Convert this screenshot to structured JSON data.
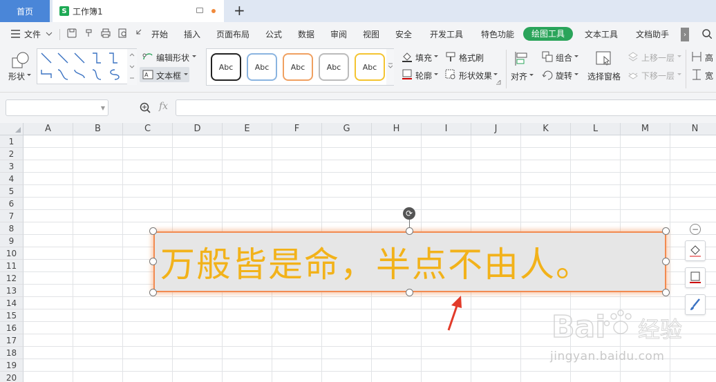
{
  "tabs": {
    "home": "首页",
    "document": "工作簿1"
  },
  "menu": {
    "file": "文件",
    "items": [
      "开始",
      "插入",
      "页面布局",
      "公式",
      "数据",
      "审阅",
      "视图",
      "安全",
      "开发工具",
      "特色功能"
    ],
    "active": "绘图工具",
    "after": [
      "文本工具",
      "文档助手"
    ]
  },
  "ribbon": {
    "shapes": "形状",
    "edit_shape": "编辑形状",
    "text_box": "文本框",
    "style_sample": "Abc",
    "fill": "填充",
    "format_painter": "格式刷",
    "outline": "轮廓",
    "shape_effects": "形状效果",
    "align": "对齐",
    "group": "组合",
    "rotate": "旋转",
    "selection_pane": "选择窗格",
    "bring_forward": "上移一层",
    "send_backward": "下移一层",
    "height_partial": "高",
    "width_partial": "宽"
  },
  "formula": {
    "fx": "fx",
    "value": ""
  },
  "grid": {
    "columns": [
      "A",
      "B",
      "C",
      "D",
      "E",
      "F",
      "G",
      "H",
      "I",
      "J",
      "K",
      "L",
      "M",
      "N"
    ],
    "rows": [
      "1",
      "2",
      "3",
      "4",
      "5",
      "6",
      "7",
      "8",
      "9",
      "10",
      "11",
      "12",
      "13",
      "14",
      "15",
      "16",
      "17",
      "18",
      "19",
      "20"
    ]
  },
  "textbox": {
    "text": "万般皆是命，半点不由人。",
    "fill": "#e6e6e6",
    "text_color": "#f2b21a",
    "border_color": "#f28a50"
  },
  "watermark": {
    "line1": "Bai",
    "line2": "经验",
    "sub": "jingyan.baidu.com"
  },
  "colors": {
    "accent": "#2aa45a",
    "home_tab": "#4a86d8"
  }
}
